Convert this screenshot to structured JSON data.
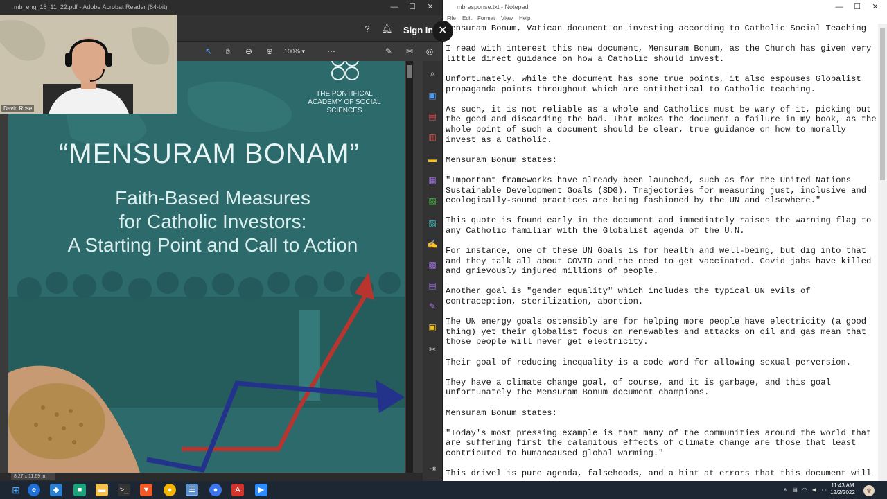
{
  "acrobat": {
    "window_title": "mb_eng_18_11_22.pdf - Adobe Acrobat Reader (64-bit)",
    "sign_in": "Sign In",
    "zoom": "100%",
    "page_size": "8.27 x 11.69 in",
    "window_controls": {
      "minimize": "—",
      "maximize": "☐",
      "close": "✕"
    }
  },
  "pdf": {
    "org": [
      "THE PONTIFICAL",
      "ACADEMY OF SOCIAL",
      "SCIENCES"
    ],
    "title": "“MENSURAM BONAM”",
    "subtitle_lines": [
      "Faith-Based Measures",
      "for Catholic Investors:",
      "A Starting Point and Call to Action"
    ]
  },
  "webcam": {
    "name": "Devin Rose"
  },
  "notepad": {
    "window_title": "mbresponse.txt - Notepad",
    "menu": [
      "File",
      "Edit",
      "Format",
      "View",
      "Help"
    ],
    "window_controls": {
      "minimize": "—",
      "maximize": "☐",
      "close": "✕"
    },
    "paragraphs": [
      "Mensuram Bonum, Vatican document on investing according to Catholic Social Teaching",
      "I read with interest this new document, Mensuram Bonum, as the Church has given very little direct guidance on how a Catholic should invest.",
      "Unfortunately, while the document has some true points, it also espouses Globalist propaganda points throughout which are antithetical to Catholic teaching.",
      "As such, it is not reliable as a whole and Catholics must be wary of it, picking out the good and discarding the bad. That makes the document a failure in my book, as the whole point of such a document should be clear, true guidance on how to morally invest as a Catholic.",
      "Mensuram Bonum states:",
      "\"Important frameworks have already been launched, such as for the United Nations Sustainable Development Goals (SDG). Trajectories for measuring just, inclusive and ecologically-sound practices are being fashioned by the UN and elsewhere.\"",
      "This quote is found early in the document and immediately raises the warning flag to any Catholic familiar with the Globalist agenda of the U.N.",
      "For instance, one of these UN Goals is for health and well-being, but dig into that and they talk all about COVID and the need to get vaccinated. Covid jabs have killed and grievously injured millions of people.",
      "Another goal is \"gender equality\" which includes the typical UN evils of contraception, sterilization, abortion.",
      "The UN energy goals ostensibly are for helping more people have electricity (a good thing) yet their globalist focus on renewables and attacks on oil and gas mean that those people will never get electricity.",
      "Their goal of reducing inequality is a code word for allowing sexual perversion.",
      "They have a climate change goal, of course, and it is garbage, and this goal unfortunately the Mensuram Bonum document champions.",
      "",
      "Mensuram Bonum states:",
      "\"Today's most pressing example is that many of the communities around the world that are suffering first the calamitous effects of climate change are those that least contributed to humancaused global warming.\"",
      "This drivel is pure agenda, falsehoods, and a hint at errors that this document will"
    ]
  },
  "taskbar": {
    "time": "11:43 AM",
    "date": "12/2/2022",
    "apps": [
      "start",
      "search",
      "vscode",
      "app-green",
      "file-explorer",
      "terminal",
      "brave",
      "chrome",
      "notepad",
      "signal",
      "acrobat",
      "zoom"
    ]
  },
  "colors": {
    "pdf_teal": "#2c6a6b",
    "arrow_red": "#b8342f",
    "arrow_blue": "#23328a",
    "taskbar": "#1c2733"
  }
}
